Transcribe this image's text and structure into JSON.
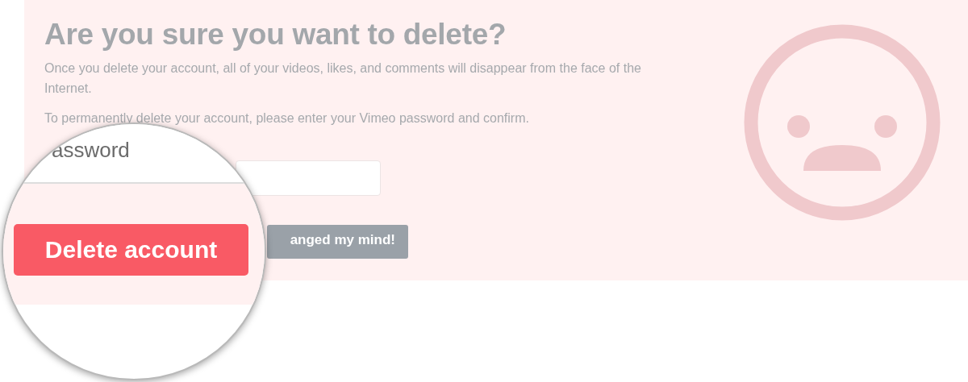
{
  "heading": "Are you sure you want to delete?",
  "paragraphs": [
    "Once you delete your account, all of your videos, likes, and comments will disappear from the face of the Internet.",
    "To permanently delete your account, please enter your Vimeo password and confirm."
  ],
  "cancel_button": "anged my mind!",
  "magnifier": {
    "label": "assword",
    "button": "Delete account"
  }
}
